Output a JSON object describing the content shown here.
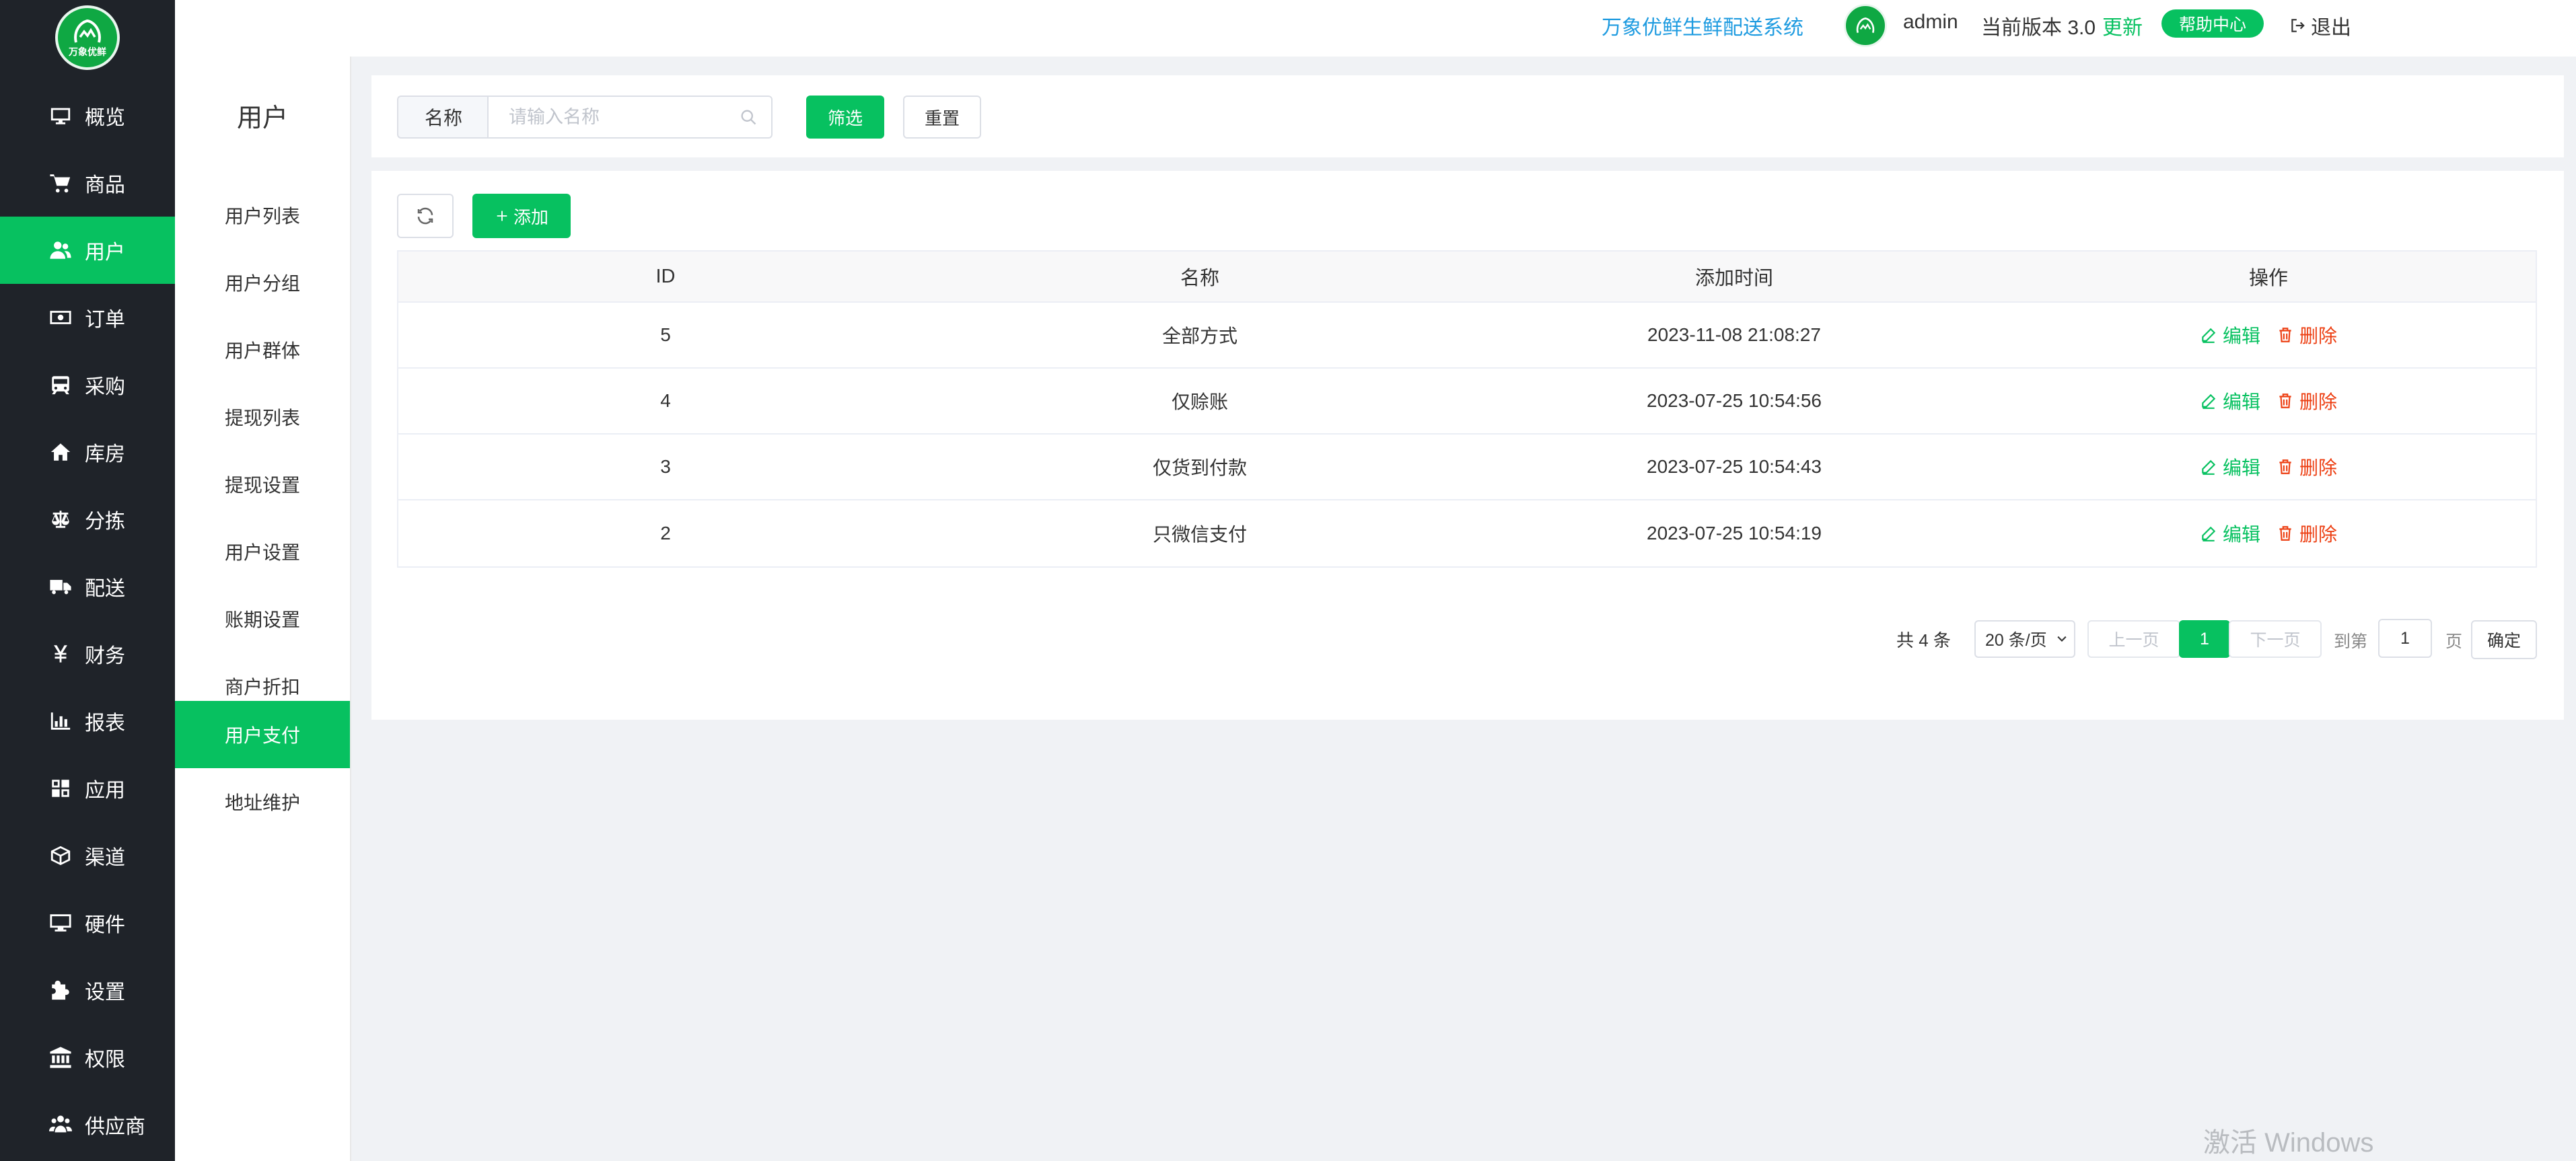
{
  "header": {
    "system_name": "万象优鲜生鲜配送系统",
    "username": "admin",
    "version_label": "当前版本 3.0",
    "update_label": "更新",
    "help_label": "帮助中心",
    "logout_label": "退出"
  },
  "logo": {
    "text": "万象优鲜"
  },
  "sidebar": {
    "items": [
      {
        "label": "概览",
        "icon": "monitor-icon"
      },
      {
        "label": "商品",
        "icon": "cart-icon"
      },
      {
        "label": "用户",
        "icon": "users-icon",
        "active": true
      },
      {
        "label": "订单",
        "icon": "money-icon"
      },
      {
        "label": "采购",
        "icon": "train-icon"
      },
      {
        "label": "库房",
        "icon": "home-icon"
      },
      {
        "label": "分拣",
        "icon": "scale-icon"
      },
      {
        "label": "配送",
        "icon": "truck-icon"
      },
      {
        "label": "财务",
        "icon": "yen-icon"
      },
      {
        "label": "报表",
        "icon": "bar-chart-icon"
      },
      {
        "label": "应用",
        "icon": "apps-icon"
      },
      {
        "label": "渠道",
        "icon": "cube-icon"
      },
      {
        "label": "硬件",
        "icon": "desktop-icon"
      },
      {
        "label": "设置",
        "icon": "puzzle-icon"
      },
      {
        "label": "权限",
        "icon": "bank-icon"
      },
      {
        "label": "供应商",
        "icon": "group-icon"
      }
    ]
  },
  "submenu": {
    "title": "用户",
    "items": [
      {
        "label": "用户列表"
      },
      {
        "label": "用户分组"
      },
      {
        "label": "用户群体"
      },
      {
        "label": "提现列表"
      },
      {
        "label": "提现设置"
      },
      {
        "label": "用户设置"
      },
      {
        "label": "账期设置"
      },
      {
        "label": "商户折扣"
      },
      {
        "label": "用户支付",
        "active": true
      },
      {
        "label": "地址维护"
      }
    ]
  },
  "filter": {
    "name_label": "名称",
    "name_placeholder": "请输入名称",
    "filter_button": "筛选",
    "reset_button": "重置"
  },
  "toolbar": {
    "add_label": "添加"
  },
  "table": {
    "columns": [
      "ID",
      "名称",
      "添加时间",
      "操作"
    ],
    "edit_label": "编辑",
    "delete_label": "删除",
    "rows": [
      {
        "id": "5",
        "name": "全部方式",
        "time": "2023-11-08 21:08:27"
      },
      {
        "id": "4",
        "name": "仅赊账",
        "time": "2023-07-25 10:54:56"
      },
      {
        "id": "3",
        "name": "仅货到付款",
        "time": "2023-07-25 10:54:43"
      },
      {
        "id": "2",
        "name": "只微信支付",
        "time": "2023-07-25 10:54:19"
      }
    ]
  },
  "pagination": {
    "total": "共 4 条",
    "page_size": "20 条/页",
    "prev": "上一页",
    "current": "1",
    "next": "下一页",
    "goto": "到第",
    "goto_value": "1",
    "page_unit": "页",
    "confirm": "确定"
  },
  "watermark": "激活 Windows",
  "colors": {
    "brand": "#07c160",
    "sidebar_bg": "#1f2329",
    "link": "#1e9be0",
    "danger": "#ed4014"
  }
}
